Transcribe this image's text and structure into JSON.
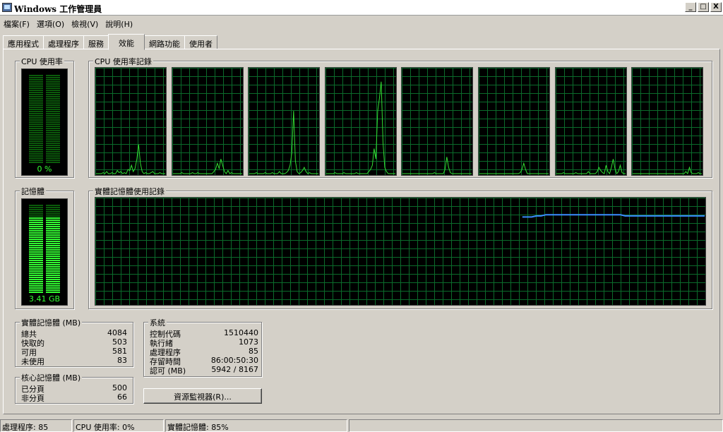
{
  "window": {
    "title": "Windows 工作管理員",
    "btn_minimize": "_",
    "btn_maximize": "□",
    "btn_close": "X"
  },
  "menu": [
    "檔案(F)",
    "選項(O)",
    "檢視(V)",
    "說明(H)"
  ],
  "tabs": [
    "應用程式",
    "處理程序",
    "服務",
    "效能",
    "網路功能",
    "使用者"
  ],
  "active_tab": "效能",
  "cpu_usage": {
    "title": "CPU 使用率",
    "value_text": "0 %",
    "fraction": 0.0
  },
  "cpu_history": {
    "title": "CPU 使用率記錄",
    "graphs": [
      [
        0,
        0,
        0,
        0,
        1,
        0,
        2,
        0,
        0,
        1,
        0,
        0,
        3,
        1,
        2,
        0,
        1,
        0,
        4,
        3,
        8,
        2,
        5,
        14,
        28,
        10,
        2,
        0,
        1,
        0,
        0,
        1,
        2,
        0,
        0,
        0,
        1,
        0,
        0,
        0
      ],
      [
        0,
        0,
        0,
        0,
        0,
        1,
        0,
        0,
        0,
        0,
        0,
        1,
        0,
        0,
        1,
        0,
        0,
        0,
        0,
        0,
        0,
        0,
        0,
        2,
        4,
        10,
        5,
        14,
        8,
        2,
        0,
        3,
        0,
        1,
        0,
        0,
        0,
        0,
        0,
        0
      ],
      [
        0,
        0,
        0,
        0,
        1,
        0,
        0,
        0,
        0,
        1,
        0,
        0,
        0,
        1,
        0,
        0,
        0,
        2,
        0,
        0,
        0,
        1,
        3,
        8,
        20,
        60,
        12,
        2,
        0,
        1,
        3,
        6,
        2,
        0,
        1,
        0,
        0,
        0,
        0,
        0
      ],
      [
        0,
        0,
        0,
        0,
        0,
        1,
        0,
        0,
        0,
        0,
        1,
        0,
        0,
        0,
        0,
        0,
        0,
        1,
        0,
        0,
        0,
        0,
        0,
        0,
        2,
        4,
        8,
        24,
        14,
        60,
        72,
        88,
        30,
        6,
        2,
        0,
        0,
        0,
        0,
        0
      ],
      [
        0,
        0,
        0,
        0,
        0,
        0,
        0,
        0,
        0,
        0,
        0,
        0,
        0,
        0,
        0,
        0,
        0,
        0,
        1,
        0,
        0,
        0,
        0,
        0,
        4,
        16,
        6,
        1,
        0,
        0,
        0,
        0,
        0,
        0,
        0,
        0,
        0,
        0,
        0,
        0
      ],
      [
        0,
        0,
        0,
        0,
        0,
        0,
        0,
        0,
        0,
        0,
        0,
        0,
        0,
        0,
        0,
        0,
        0,
        0,
        0,
        0,
        0,
        0,
        0,
        1,
        4,
        10,
        4,
        0,
        0,
        0,
        0,
        0,
        0,
        0,
        0,
        0,
        0,
        0,
        0,
        0
      ],
      [
        0,
        0,
        0,
        0,
        1,
        0,
        0,
        0,
        0,
        0,
        0,
        1,
        0,
        0,
        0,
        0,
        0,
        0,
        2,
        0,
        0,
        0,
        0,
        2,
        6,
        3,
        1,
        0,
        8,
        2,
        0,
        6,
        14,
        5,
        0,
        2,
        8,
        1,
        0,
        0
      ],
      [
        0,
        0,
        0,
        0,
        0,
        0,
        0,
        0,
        0,
        0,
        0,
        0,
        0,
        0,
        0,
        0,
        0,
        0,
        0,
        0,
        0,
        0,
        0,
        0,
        0,
        0,
        0,
        0,
        0,
        0,
        2,
        0,
        6,
        1,
        0,
        0,
        0,
        1,
        0,
        0
      ]
    ]
  },
  "memory": {
    "title": "記憶體",
    "value_text": "3.41 GB",
    "fraction": 0.85
  },
  "memory_history": {
    "title": "實體記憶體使用記錄",
    "start_fraction": 0.7,
    "values": [
      82,
      82,
      82,
      83,
      83,
      84,
      84,
      84,
      84,
      84,
      84,
      84,
      84,
      84,
      84,
      84,
      84,
      84,
      84,
      84,
      84,
      84,
      83,
      83,
      83,
      83,
      83,
      83,
      83,
      83,
      83,
      83,
      83,
      83,
      83,
      83,
      83,
      83,
      83,
      83
    ]
  },
  "physical_memory": {
    "title": "實體記憶體 (MB)",
    "rows": [
      {
        "k": "總共",
        "v": "4084"
      },
      {
        "k": "快取的",
        "v": "503"
      },
      {
        "k": "可用",
        "v": "581"
      },
      {
        "k": "未使用",
        "v": "83"
      }
    ]
  },
  "kernel_memory": {
    "title": "核心記憶體 (MB)",
    "rows": [
      {
        "k": "已分頁",
        "v": "500"
      },
      {
        "k": "非分頁",
        "v": "66"
      }
    ]
  },
  "system": {
    "title": "系統",
    "rows": [
      {
        "k": "控制代碼",
        "v": "1510440"
      },
      {
        "k": "執行緒",
        "v": "1073"
      },
      {
        "k": "處理程序",
        "v": "85"
      },
      {
        "k": "存留時間",
        "v": "86:00:50:30"
      },
      {
        "k": "認可 (MB)",
        "v": "5942 / 8167"
      }
    ]
  },
  "resource_monitor_button": "資源監視器(R)...",
  "status": {
    "processes": "處理程序: 85",
    "cpu": "CPU 使用率: 0%",
    "memory": "實體記憶體: 85%"
  },
  "colors": {
    "cpu_line": "#33e033",
    "memory_line": "#3a8cff",
    "meter_on": "#33ff33",
    "meter_off": "#0b5a0b"
  }
}
